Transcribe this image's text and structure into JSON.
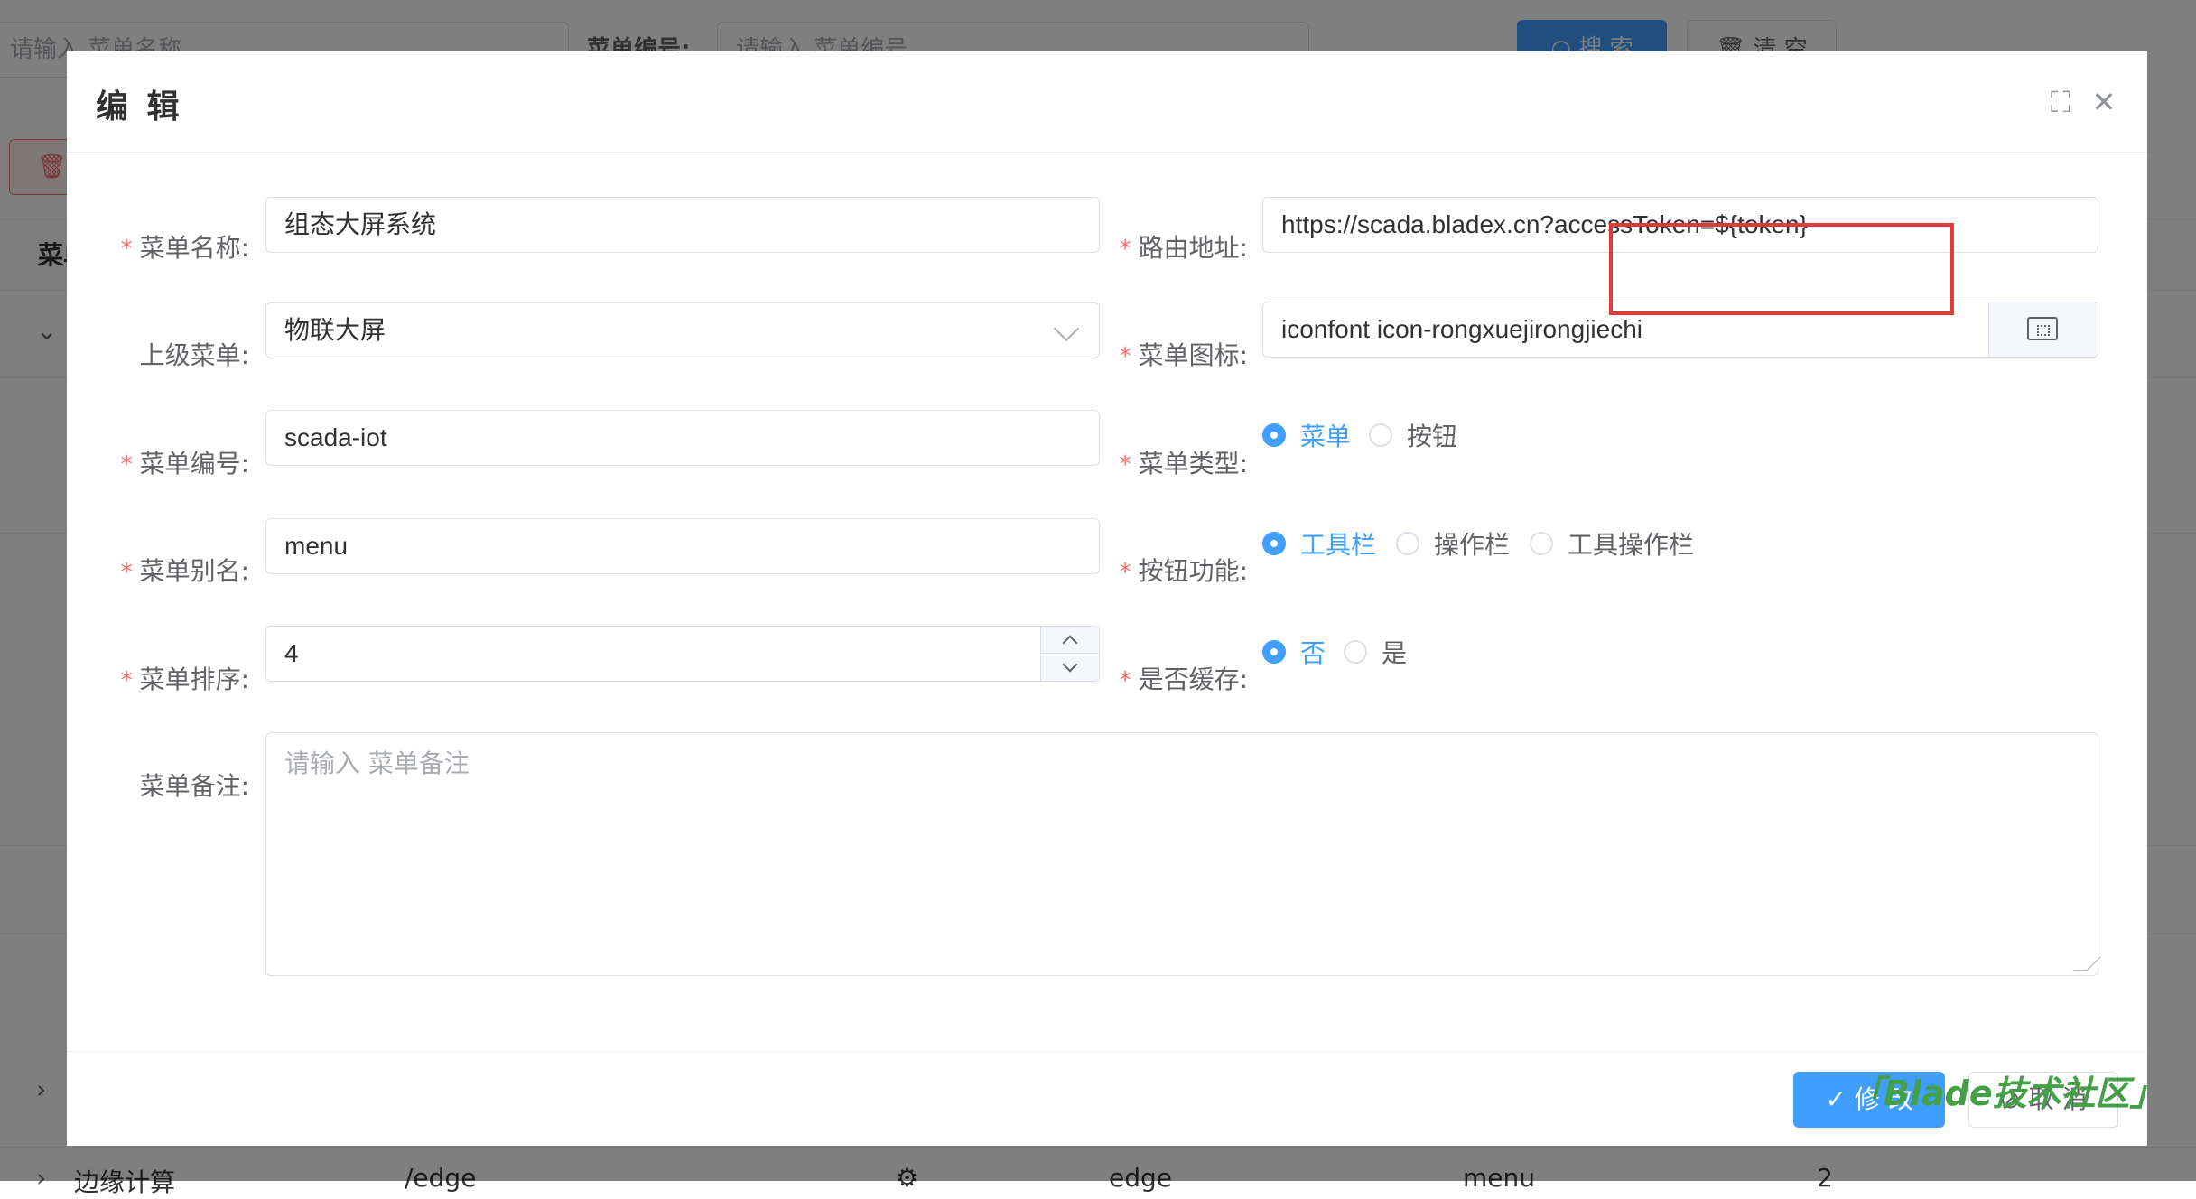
{
  "background": {
    "search_name_placeholder": "请输入 菜单名称",
    "menu_code_label": "菜单编号:",
    "menu_code_placeholder": "请输入 菜单编号",
    "search_button": "搜 索",
    "clear_button": "清 空",
    "table_header_first": "菜单",
    "row_edge_name": "边缘计算",
    "row_edge_path": "/edge",
    "row_edge_code": "edge",
    "row_edge_alias": "menu",
    "row_edge_sort": "2"
  },
  "dialog": {
    "title": "编 辑",
    "fields": {
      "menu_name": {
        "label": "菜单名称:",
        "value": "组态大屏系统"
      },
      "route": {
        "label": "路由地址:",
        "value": "https://scada.bladex.cn?accessToken=${token}"
      },
      "parent_menu": {
        "label": "上级菜单:",
        "value": "物联大屏"
      },
      "menu_icon": {
        "label": "菜单图标:",
        "value": "iconfont icon-rongxuejirongjiechi"
      },
      "menu_code": {
        "label": "菜单编号:",
        "value": "scada-iot"
      },
      "menu_type": {
        "label": "菜单类型:",
        "options": [
          "菜单",
          "按钮"
        ],
        "selected": "菜单"
      },
      "menu_alias": {
        "label": "菜单别名:",
        "value": "menu"
      },
      "button_function": {
        "label": "按钮功能:",
        "options": [
          "工具栏",
          "操作栏",
          "工具操作栏"
        ],
        "selected": "工具栏"
      },
      "menu_sort": {
        "label": "菜单排序:",
        "value": "4"
      },
      "cache": {
        "label": "是否缓存:",
        "options": [
          "否",
          "是"
        ],
        "selected": "否"
      },
      "remark": {
        "label": "菜单备注:",
        "placeholder": "请输入 菜单备注"
      }
    },
    "footer": {
      "save": "修 改",
      "cancel": "取 消"
    }
  },
  "watermark": "「Blade技术社区」",
  "colors": {
    "primary": "#409eff",
    "required": "#f56c6c",
    "highlight_box": "#e53935",
    "watermark": "#43a047"
  }
}
